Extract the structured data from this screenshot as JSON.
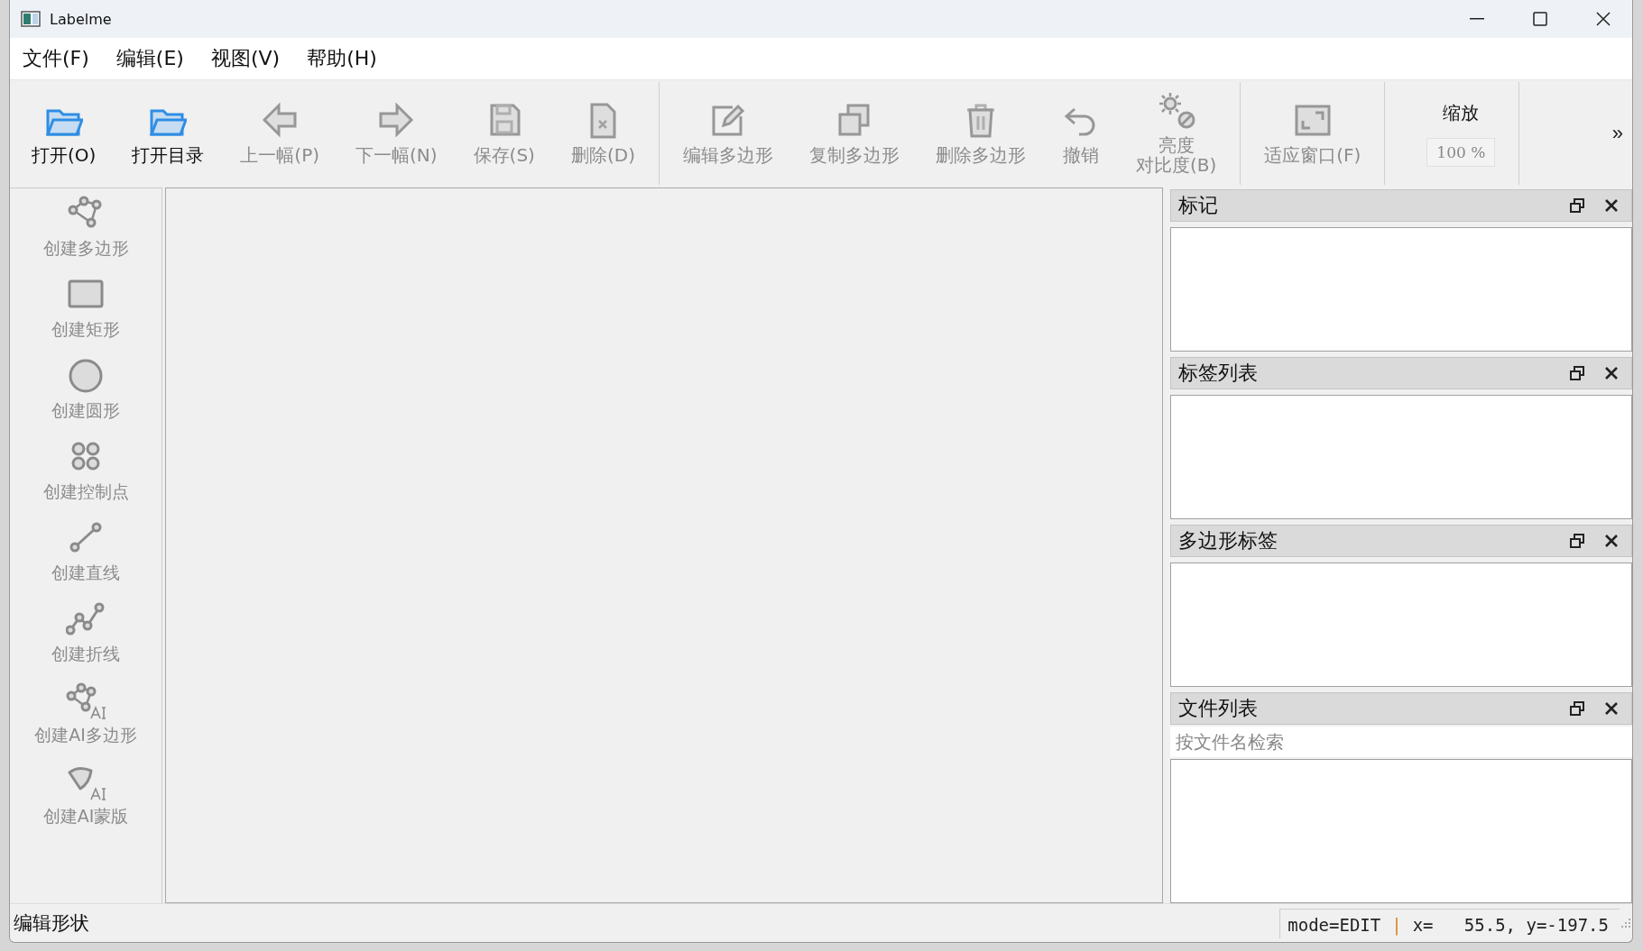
{
  "window": {
    "title": "Labelme"
  },
  "menu": [
    {
      "label": "文件(F)"
    },
    {
      "label": "编辑(E)"
    },
    {
      "label": "视图(V)"
    },
    {
      "label": "帮助(H)"
    }
  ],
  "toolbar": {
    "groups": [
      [
        {
          "label": "打开(O)",
          "disabled": false
        },
        {
          "label": "打开目录",
          "disabled": false
        },
        {
          "label": "上一幅(P)",
          "disabled": true
        },
        {
          "label": "下一幅(N)",
          "disabled": true
        },
        {
          "label": "保存(S)",
          "disabled": true
        },
        {
          "label": "删除(D)",
          "disabled": true
        }
      ],
      [
        {
          "label": "编辑多边形",
          "disabled": true
        },
        {
          "label": "复制多边形",
          "disabled": true
        },
        {
          "label": "删除多边形",
          "disabled": true
        },
        {
          "label": "撤销",
          "disabled": true
        },
        {
          "lines": [
            "亮度",
            "对比度(B)"
          ],
          "disabled": true
        }
      ],
      [
        {
          "label": "适应窗口(F)",
          "disabled": true
        }
      ]
    ],
    "zoom": {
      "label": "缩放",
      "value": "100 %",
      "disabled": true
    },
    "overflow": "»"
  },
  "tools": [
    {
      "label": "创建多边形",
      "disabled": true
    },
    {
      "label": "创建矩形",
      "disabled": true
    },
    {
      "label": "创建圆形",
      "disabled": true
    },
    {
      "label": "创建控制点",
      "disabled": true
    },
    {
      "label": "创建直线",
      "disabled": true
    },
    {
      "label": "创建折线",
      "disabled": true
    },
    {
      "label": "创建AI多边形",
      "disabled": true
    },
    {
      "label": "创建AI蒙版",
      "disabled": true
    }
  ],
  "docks": [
    {
      "title": "标记"
    },
    {
      "title": "标签列表"
    },
    {
      "title": "多边形标签"
    },
    {
      "title": "文件列表",
      "search": {
        "placeholder": "按文件名检索"
      }
    }
  ],
  "status_bar": {
    "message": "编辑形状",
    "mode": "mode=EDIT",
    "separator": "|",
    "coords": "x=   55.5, y=-197.5"
  }
}
